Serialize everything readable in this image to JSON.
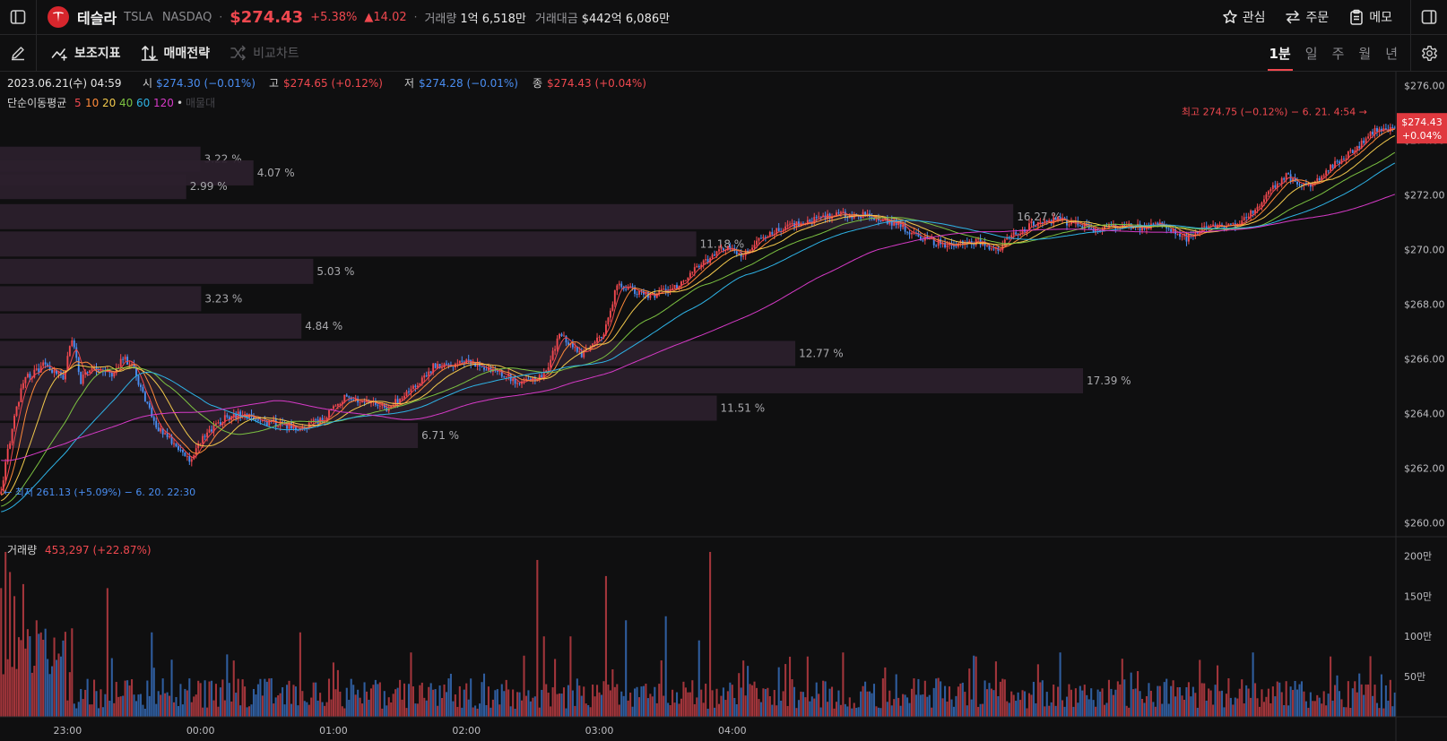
{
  "header": {
    "stock_name": "테슬라",
    "ticker": "TSLA",
    "exchange": "NASDAQ",
    "price": "$274.43",
    "change_pct": "+5.38%",
    "change_abs": "▲14.02",
    "volume_label": "거래량",
    "volume_value": "1억 6,518만",
    "amount_label": "거래대금",
    "amount_value": "$442억 6,086만",
    "actions": [
      {
        "label": "관심",
        "icon": "star-icon"
      },
      {
        "label": "주문",
        "icon": "swap-arrows-icon"
      },
      {
        "label": "메모",
        "icon": "clipboard-icon"
      }
    ]
  },
  "toolbar": {
    "indicators_label": "보조지표",
    "strategy_label": "매매전략",
    "compare_label": "비교차트",
    "periods": [
      "1분",
      "일",
      "주",
      "월",
      "년"
    ],
    "active_period": "1분"
  },
  "chart_data": {
    "type": "candlestick",
    "symbol": "TSLA",
    "interval": "1분",
    "ohlc_info": {
      "date": "2023.06.21(수) 04:59",
      "open_label": "시",
      "open": "$274.30 (−0.01%)",
      "high_label": "고",
      "high": "$274.65 (+0.12%)",
      "low_label": "저",
      "low": "$274.28 (−0.01%)",
      "close_label": "종",
      "close": "$274.43 (+0.04%)"
    },
    "ma_legend": {
      "title": "단순이동평균",
      "periods": [
        {
          "label": "5",
          "color": "#f0484f"
        },
        {
          "label": "10",
          "color": "#ff8a3a"
        },
        {
          "label": "20",
          "color": "#f2c94c"
        },
        {
          "label": "40",
          "color": "#7cc241"
        },
        {
          "label": "60",
          "color": "#2eb3e6"
        },
        {
          "label": "120",
          "color": "#d63ac7"
        }
      ],
      "extra": "매물대"
    },
    "price_axis": {
      "ticks": [
        260,
        262,
        264,
        266,
        268,
        270,
        272,
        274,
        276
      ],
      "tick_labels": [
        "$260.00",
        "$262.00",
        "$264.00",
        "$266.00",
        "$268.00",
        "$270.00",
        "$272.00",
        "$274.00",
        "$276.00"
      ],
      "range": [
        259.5,
        276.5
      ]
    },
    "current_price_tag": {
      "price": "$274.43",
      "change": "+0.04%",
      "value": 274.43
    },
    "high_marker": {
      "text": "최고 274.75 (−0.12%) − 6. 21. 4:54",
      "value": 274.75
    },
    "low_marker": {
      "text": "최저 261.13 (+5.09%) − 6. 20. 22:30",
      "value": 261.13
    },
    "time_axis": {
      "labels": [
        "23:00",
        "00:00",
        "01:00",
        "02:00",
        "03:00",
        "04:00"
      ],
      "start": "22:30",
      "end": "04:59"
    },
    "price_anchors": [
      [
        0,
        261.2
      ],
      [
        5,
        263.5
      ],
      [
        10,
        265.2
      ],
      [
        20,
        265.8
      ],
      [
        28,
        265.3
      ],
      [
        32,
        266.8
      ],
      [
        36,
        265.2
      ],
      [
        40,
        265.7
      ],
      [
        50,
        265.4
      ],
      [
        55,
        266.1
      ],
      [
        60,
        265.6
      ],
      [
        70,
        263.5
      ],
      [
        80,
        262.8
      ],
      [
        85,
        262.3
      ],
      [
        90,
        263.0
      ],
      [
        100,
        263.8
      ],
      [
        110,
        264.0
      ],
      [
        120,
        263.7
      ],
      [
        135,
        263.5
      ],
      [
        145,
        263.8
      ],
      [
        155,
        264.6
      ],
      [
        165,
        264.4
      ],
      [
        175,
        264.2
      ],
      [
        185,
        264.9
      ],
      [
        195,
        265.7
      ],
      [
        210,
        265.9
      ],
      [
        225,
        265.5
      ],
      [
        235,
        265.1
      ],
      [
        245,
        265.4
      ],
      [
        252,
        266.9
      ],
      [
        262,
        266.2
      ],
      [
        272,
        267.0
      ],
      [
        278,
        268.7
      ],
      [
        285,
        268.5
      ],
      [
        295,
        268.3
      ],
      [
        305,
        268.7
      ],
      [
        318,
        269.6
      ],
      [
        327,
        270.1
      ],
      [
        335,
        269.8
      ],
      [
        345,
        270.5
      ],
      [
        360,
        271.0
      ],
      [
        375,
        271.2
      ],
      [
        387,
        271.3
      ],
      [
        397,
        271.1
      ],
      [
        405,
        270.9
      ],
      [
        415,
        270.4
      ],
      [
        425,
        270.2
      ],
      [
        440,
        270.3
      ],
      [
        450,
        270.0
      ],
      [
        455,
        270.4
      ],
      [
        465,
        270.9
      ],
      [
        475,
        271.1
      ],
      [
        485,
        270.9
      ],
      [
        495,
        270.7
      ],
      [
        505,
        270.9
      ],
      [
        515,
        270.8
      ],
      [
        525,
        270.9
      ],
      [
        535,
        270.4
      ],
      [
        545,
        270.8
      ],
      [
        555,
        270.9
      ],
      [
        562,
        271.1
      ],
      [
        570,
        271.9
      ],
      [
        580,
        272.7
      ],
      [
        590,
        272.3
      ],
      [
        600,
        273.0
      ],
      [
        610,
        273.6
      ],
      [
        620,
        274.4
      ],
      [
        630,
        274.43
      ]
    ],
    "moving_averages": [
      {
        "period": 5,
        "color": "#f0484f",
        "start": 261.2
      },
      {
        "period": 10,
        "color": "#ff8a3a",
        "start": 261.0
      },
      {
        "period": 20,
        "color": "#f2c94c",
        "start": 260.8
      },
      {
        "period": 40,
        "color": "#7cc241",
        "start": 260.6
      },
      {
        "period": 60,
        "color": "#2eb3e6",
        "start": 260.4
      },
      {
        "period": 120,
        "color": "#d63ac7",
        "start": 262.3
      }
    ],
    "volume_profile": [
      {
        "price": 273.3,
        "pct": 3.22,
        "label": "3.22 %"
      },
      {
        "price": 272.8,
        "pct": 4.07,
        "label": "4.07 %"
      },
      {
        "price": 272.3,
        "pct": 2.99,
        "label": "2.99 %"
      },
      {
        "price": 271.2,
        "pct": 16.27,
        "label": "16.27 %"
      },
      {
        "price": 270.2,
        "pct": 11.18,
        "label": "11.18 %"
      },
      {
        "price": 269.2,
        "pct": 5.03,
        "label": "5.03 %"
      },
      {
        "price": 268.2,
        "pct": 3.23,
        "label": "3.23 %"
      },
      {
        "price": 267.2,
        "pct": 4.84,
        "label": "4.84 %"
      },
      {
        "price": 266.2,
        "pct": 12.77,
        "label": "12.77 %"
      },
      {
        "price": 265.2,
        "pct": 17.39,
        "label": "17.39 %"
      },
      {
        "price": 264.2,
        "pct": 11.51,
        "label": "11.51 %"
      },
      {
        "price": 263.2,
        "pct": 6.71,
        "label": "6.71 %"
      }
    ],
    "volume": {
      "label": "거래량",
      "info": "453,297 (+22.87%)",
      "ticks": [
        50,
        100,
        150,
        200
      ],
      "tick_labels": [
        "50만",
        "100만",
        "150만",
        "200만"
      ],
      "unit": "만",
      "max": 215,
      "spikes": [
        {
          "i": 0,
          "v": 160
        },
        {
          "i": 2,
          "v": 205
        },
        {
          "i": 4,
          "v": 180
        },
        {
          "i": 6,
          "v": 150
        },
        {
          "i": 10,
          "v": 165
        },
        {
          "i": 16,
          "v": 120
        },
        {
          "i": 32,
          "v": 110
        },
        {
          "i": 48,
          "v": 160
        },
        {
          "i": 68,
          "v": 105
        },
        {
          "i": 105,
          "v": 70
        },
        {
          "i": 135,
          "v": 105
        },
        {
          "i": 185,
          "v": 80
        },
        {
          "i": 242,
          "v": 195
        },
        {
          "i": 245,
          "v": 100
        },
        {
          "i": 257,
          "v": 100
        },
        {
          "i": 273,
          "v": 175
        },
        {
          "i": 282,
          "v": 120
        },
        {
          "i": 300,
          "v": 125
        },
        {
          "i": 315,
          "v": 95
        },
        {
          "i": 320,
          "v": 205
        },
        {
          "i": 335,
          "v": 70
        },
        {
          "i": 380,
          "v": 80
        },
        {
          "i": 440,
          "v": 75
        },
        {
          "i": 478,
          "v": 80
        },
        {
          "i": 510,
          "v": 55
        },
        {
          "i": 565,
          "v": 80
        },
        {
          "i": 600,
          "v": 75
        }
      ]
    }
  }
}
